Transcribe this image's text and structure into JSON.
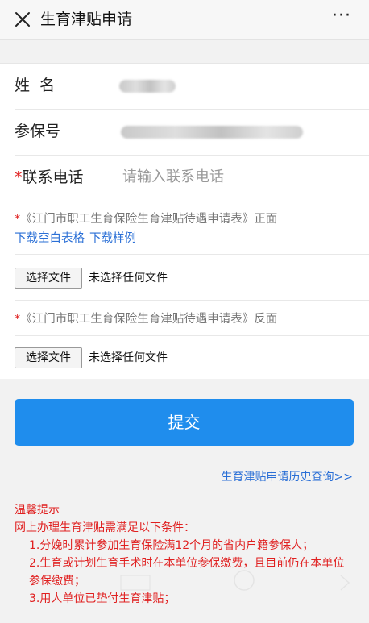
{
  "nav": {
    "title": "生育津贴申请",
    "more": "···"
  },
  "form": {
    "name_label": "姓  名",
    "insure_label": "参保号",
    "phone_label": "联系电话",
    "phone_required": "*",
    "phone_placeholder": "请输入联系电话"
  },
  "upload": [
    {
      "required": "*",
      "title": "《江门市职工生育保险生育津贴待遇申请表》正面",
      "links": [
        "下载空白表格",
        "下载样例"
      ],
      "button": "选择文件",
      "status": "未选择任何文件"
    },
    {
      "required": "*",
      "title": "《江门市职工生育保险生育津贴待遇申请表》反面",
      "button": "选择文件",
      "status": "未选择任何文件"
    }
  ],
  "submit_label": "提交",
  "history_link": "生育津贴申请历史查询>>",
  "notes": {
    "title": "温馨提示",
    "intro": "网上办理生育津贴需满足以下条件：",
    "items": [
      "1.分娩时累计参加生育保险满12个月的省内户籍参保人；",
      "2.生育或计划生育手术时在本单位参保缴费，且目前仍在本单位参保缴费；",
      "3.用人单位已垫付生育津贴；"
    ]
  }
}
